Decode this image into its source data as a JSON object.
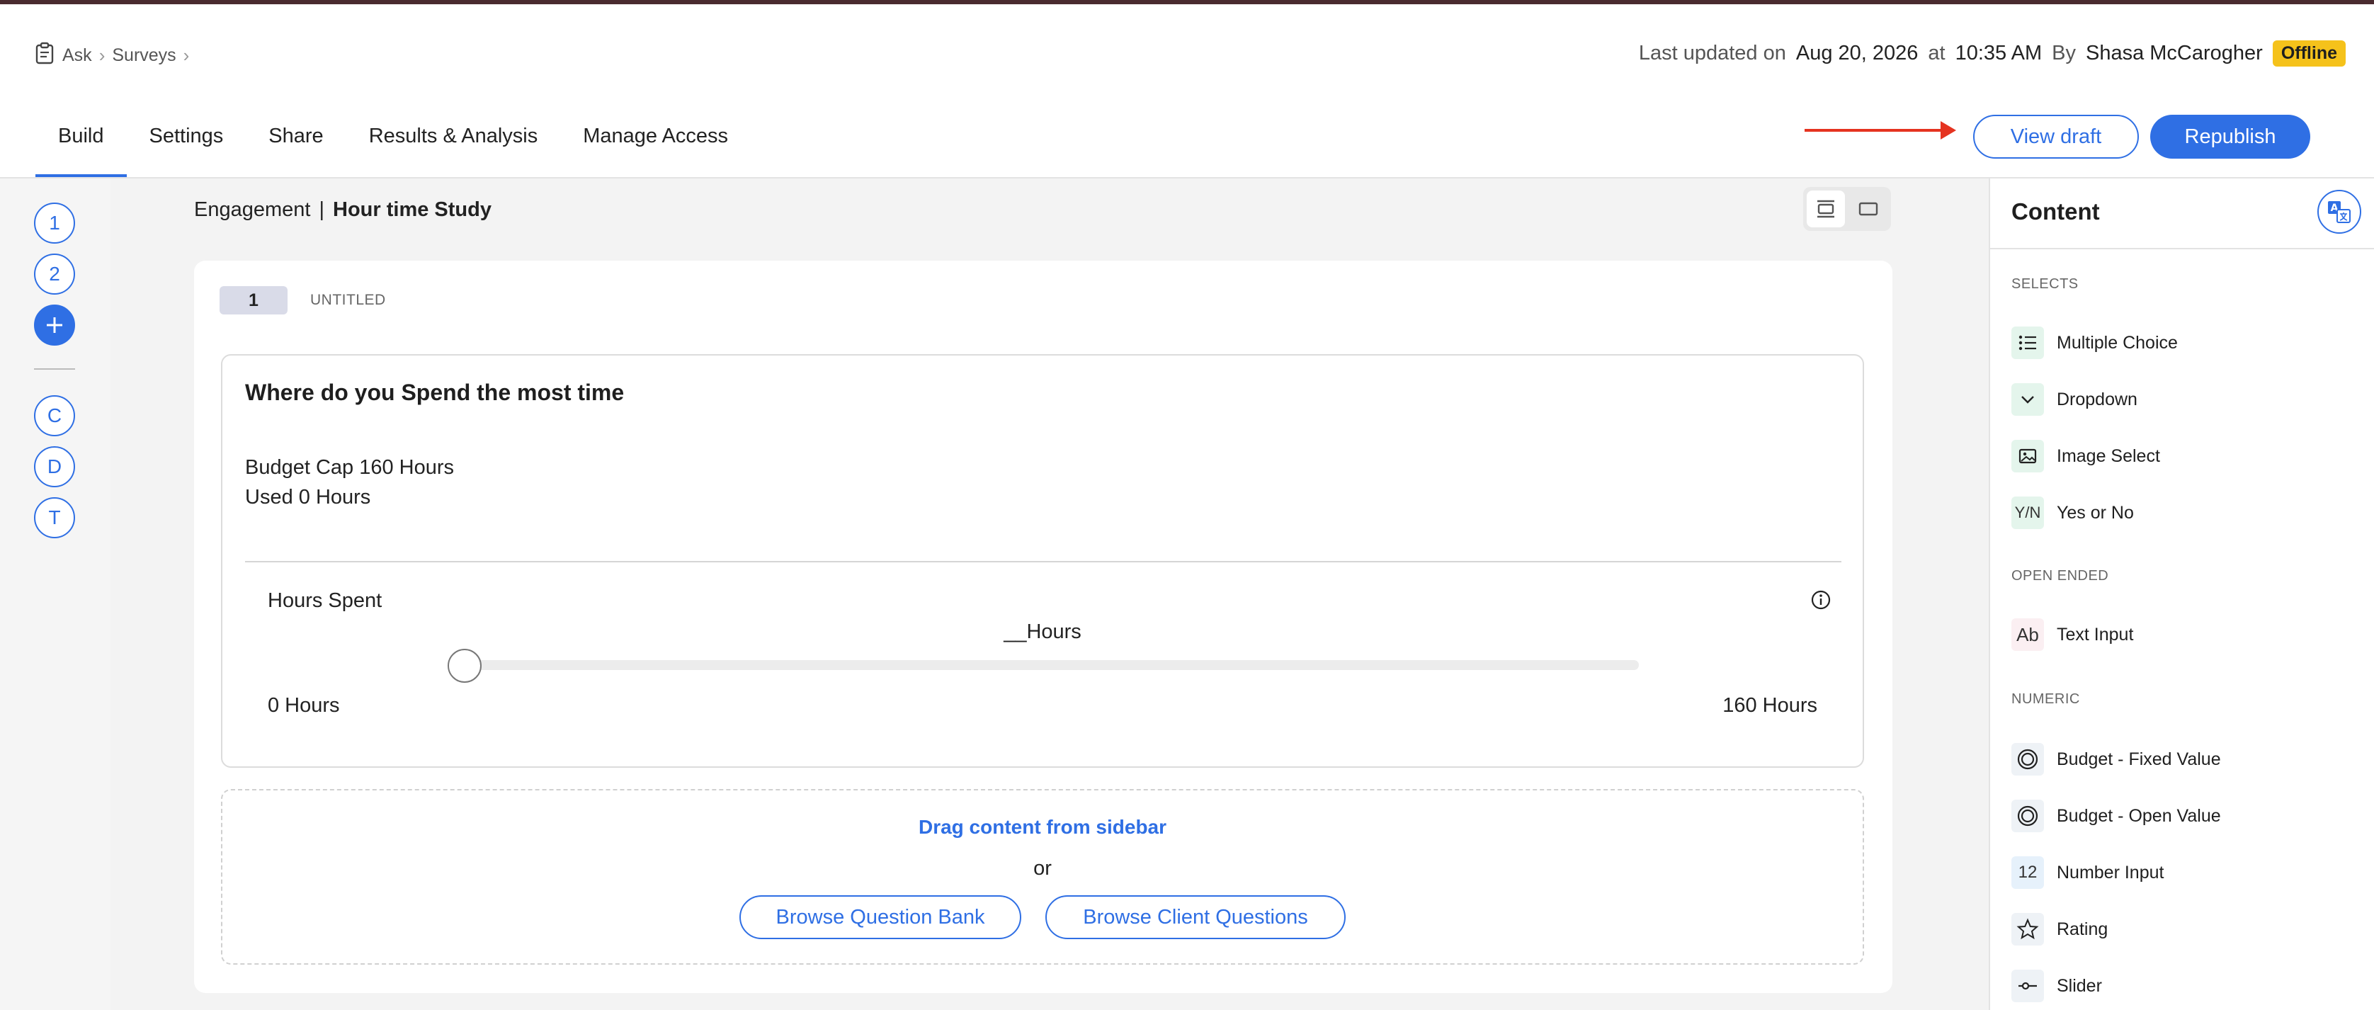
{
  "breadcrumb": {
    "items": [
      "Ask",
      "Surveys"
    ]
  },
  "header": {
    "last_updated_label": "Last updated on",
    "date": "Aug 20, 2026",
    "at_label": "at",
    "time": "10:35 AM",
    "by_label": "By",
    "author": "Shasa McCarogher",
    "status": "Offline"
  },
  "tabs": [
    {
      "label": "Build",
      "active": true
    },
    {
      "label": "Settings"
    },
    {
      "label": "Share"
    },
    {
      "label": "Results & Analysis"
    },
    {
      "label": "Manage Access"
    }
  ],
  "actions": {
    "view_draft": "View draft",
    "republish": "Republish"
  },
  "rail": {
    "pages": [
      "1",
      "2"
    ],
    "add": "+",
    "extras": [
      "C",
      "D",
      "T"
    ]
  },
  "survey": {
    "category": "Engagement",
    "separator": "|",
    "name": "Hour time Study"
  },
  "page": {
    "number": "1",
    "title": "UNTITLED"
  },
  "question": {
    "title": "Where do you Spend the most time",
    "budget_cap": "Budget Cap 160 Hours",
    "used": "Used 0 Hours",
    "field_label": "Hours Spent",
    "value_text": "__Hours",
    "slider_value": 0,
    "min_label": "0 Hours",
    "max_label": "160 Hours"
  },
  "dropzone": {
    "title": "Drag content from sidebar",
    "or": "or",
    "browse_bank": "Browse Question Bank",
    "browse_client": "Browse Client Questions"
  },
  "sidebar": {
    "title": "Content",
    "sections": [
      {
        "label": "SELECTS",
        "items": [
          "Multiple Choice",
          "Dropdown",
          "Image Select",
          "Yes or No"
        ]
      },
      {
        "label": "OPEN ENDED",
        "items": [
          "Text Input"
        ]
      },
      {
        "label": "NUMERIC",
        "items": [
          "Budget - Fixed Value",
          "Budget - Open Value",
          "Number Input",
          "Rating",
          "Slider"
        ]
      }
    ],
    "icon_text": {
      "yes_no": "Y/N",
      "text_input": "Ab",
      "number_input": "12"
    }
  },
  "colors": {
    "accent": "#2f6fe4",
    "offline_badge": "#f5c21b",
    "annotation_arrow": "#e53320"
  }
}
